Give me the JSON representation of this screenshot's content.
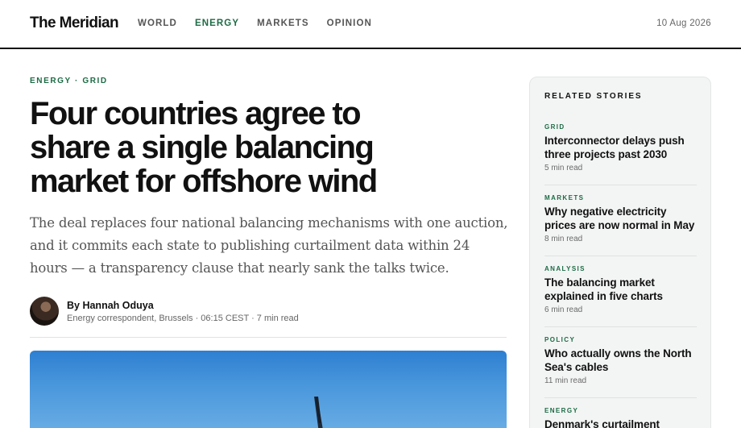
{
  "site": {
    "name": "The Meridian",
    "date": "10 Aug 2026"
  },
  "nav": [
    {
      "label": "WORLD",
      "active": false
    },
    {
      "label": "ENERGY",
      "active": true
    },
    {
      "label": "MARKETS",
      "active": false
    },
    {
      "label": "OPINION",
      "active": false
    }
  ],
  "article": {
    "kicker": "ENERGY · GRID",
    "headline": "Four countries agree to share a single balancing market for offshore wind",
    "dek": "The deal replaces four national balancing mechanisms with one auction, and it commits each state to publishing curtailment data within 24 hours — a transparency clause that nearly sank the talks twice.",
    "author": "By Hannah Oduya",
    "author_meta": "Energy correspondent, Brussels · 06:15 CEST · 7 min read"
  },
  "sidebar": {
    "title": "RELATED STORIES",
    "stories": [
      {
        "category": "GRID",
        "title": "Interconnector delays push three projects past 2030",
        "read_time": "5 min read"
      },
      {
        "category": "MARKETS",
        "title": "Why negative electricity prices are now normal in May",
        "read_time": "8 min read"
      },
      {
        "category": "ANALYSIS",
        "title": "The balancing market explained in five charts",
        "read_time": "6 min read"
      },
      {
        "category": "POLICY",
        "title": "Who actually owns the North Sea's cables",
        "read_time": "11 min read"
      },
      {
        "category": "ENERGY",
        "title": "Denmark's curtailment",
        "read_time": ""
      }
    ]
  },
  "colors": {
    "accent": "#1d6b45",
    "text": "#111111",
    "muted": "#555555",
    "sidebar_bg": "#f3f5f4"
  }
}
